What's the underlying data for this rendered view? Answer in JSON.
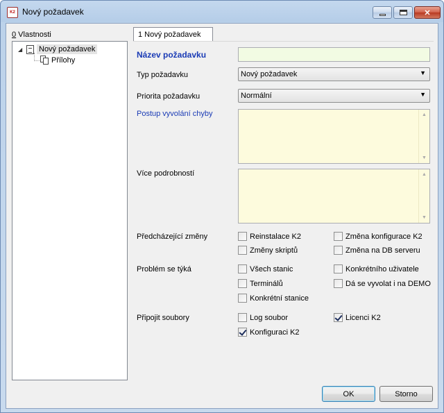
{
  "window": {
    "title": "Nový požadavek",
    "app_icon_text": "K2",
    "min_symbol": "",
    "close_symbol": "✕"
  },
  "tree": {
    "label_prefix": "0",
    "label": " Vlastnosti",
    "root": "Nový požadavek",
    "child": "Přílohy"
  },
  "tab": {
    "label": "1 Nový požadavek"
  },
  "form": {
    "name_label": "Název požadavku",
    "name_value": "",
    "type_label": "Typ požadavku",
    "type_value": "Nový požadavek",
    "priority_label": "Priorita požadavku",
    "priority_value": "Normální",
    "steps_label": "Postup vyvolání chyby",
    "details_label": "Více podrobností",
    "prev_changes_label": "Předcházející změny",
    "problem_label": "Problém se týká",
    "attach_label": "Připojit soubory"
  },
  "checkboxes": {
    "reinstall": {
      "label": "Reinstalace K2",
      "checked": false
    },
    "config_change": {
      "label": "Změna konfigurace K2",
      "checked": false
    },
    "scripts": {
      "label": "Změny skriptů",
      "checked": false
    },
    "db_change": {
      "label": "Změna na DB serveru",
      "checked": false
    },
    "all_stations": {
      "label": "Všech stanic",
      "checked": false
    },
    "specific_user": {
      "label": "Konkrétního uživatele",
      "checked": false
    },
    "terminals": {
      "label": "Terminálů",
      "checked": false
    },
    "demo": {
      "label": "Dá se vyvolat i na DEMO",
      "checked": false
    },
    "specific_station": {
      "label": "Konkrétní stanice",
      "checked": false
    },
    "log_file": {
      "label": "Log soubor",
      "checked": false
    },
    "license": {
      "label": "Licenci K2",
      "checked": true
    },
    "config_k2": {
      "label": "Konfiguraci K2",
      "checked": true
    }
  },
  "buttons": {
    "ok": "OK",
    "cancel": "Storno"
  },
  "colors": {
    "required_label": "#1a3bb5",
    "name_field_bg": "#f2fbe3",
    "textarea_bg": "#fdfbdd"
  }
}
